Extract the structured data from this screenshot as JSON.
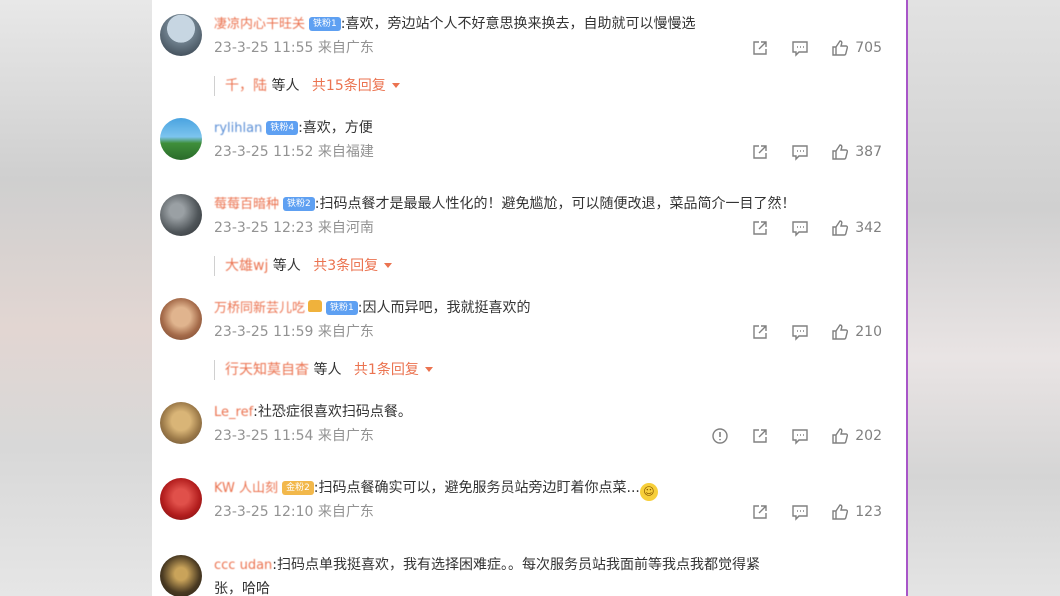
{
  "comments": [
    {
      "name": "凄凉内心干旺关",
      "badge": "铁粉1",
      "text": ":喜欢，旁边站个人不好意思换来换去，自助就可以慢慢选",
      "meta": "23-3-25 11:55 来自广东",
      "likes": "705",
      "reply_names": "千，陆",
      "reply_suffix": "等人",
      "reply_more": "共15条回复"
    },
    {
      "name": "rylihlan",
      "badge": "铁粉4",
      "text": ":喜欢，方便",
      "meta": "23-3-25 11:52 来自福建",
      "likes": "387"
    },
    {
      "name": "莓莓百暗种",
      "badge": "铁粉2",
      "text": ":扫码点餐才是最最人性化的！避免尴尬，可以随便改退，菜品简介一目了然！",
      "meta": "23-3-25 12:23 来自河南",
      "likes": "342",
      "reply_names": "大雄wj",
      "reply_suffix": "等人",
      "reply_more": "共3条回复"
    },
    {
      "name": "万桥同新芸儿吃",
      "badge": "铁粉1",
      "text": ":因人而异吧，我就挺喜欢的",
      "meta": "23-3-25 11:59 来自广东",
      "likes": "210",
      "reply_names": "行天知莫自杳",
      "reply_suffix": "等人",
      "reply_more": "共1条回复"
    },
    {
      "name": "Le_ref",
      "text": ":社恐症很喜欢扫码点餐。",
      "meta": "23-3-25 11:54 来自广东",
      "likes": "202"
    },
    {
      "name": "KW 人山刻",
      "badge": "金粉2",
      "text": ":扫码点餐确实可以，避免服务员站旁边盯着你点菜...",
      "meta": "23-3-25 12:10 来自广东",
      "likes": "123"
    },
    {
      "name": "ccc udan",
      "text": ":扫码点单我挺喜欢，我有选择困难症。。每次服务员站我面前等我点我都觉得紧",
      "text2": "张，哈哈"
    }
  ],
  "icons": {
    "share": "share-icon",
    "comment": "comment-icon",
    "like": "thumbs-up-icon",
    "report": "report-icon",
    "caret": "caret-down-icon"
  },
  "colors": {
    "accent": "#eb7350",
    "meta_gray": "#939393",
    "badge_blue": "#5ea0f2",
    "badge_gold": "#f2b84b",
    "panel_border": "#a855c8"
  }
}
